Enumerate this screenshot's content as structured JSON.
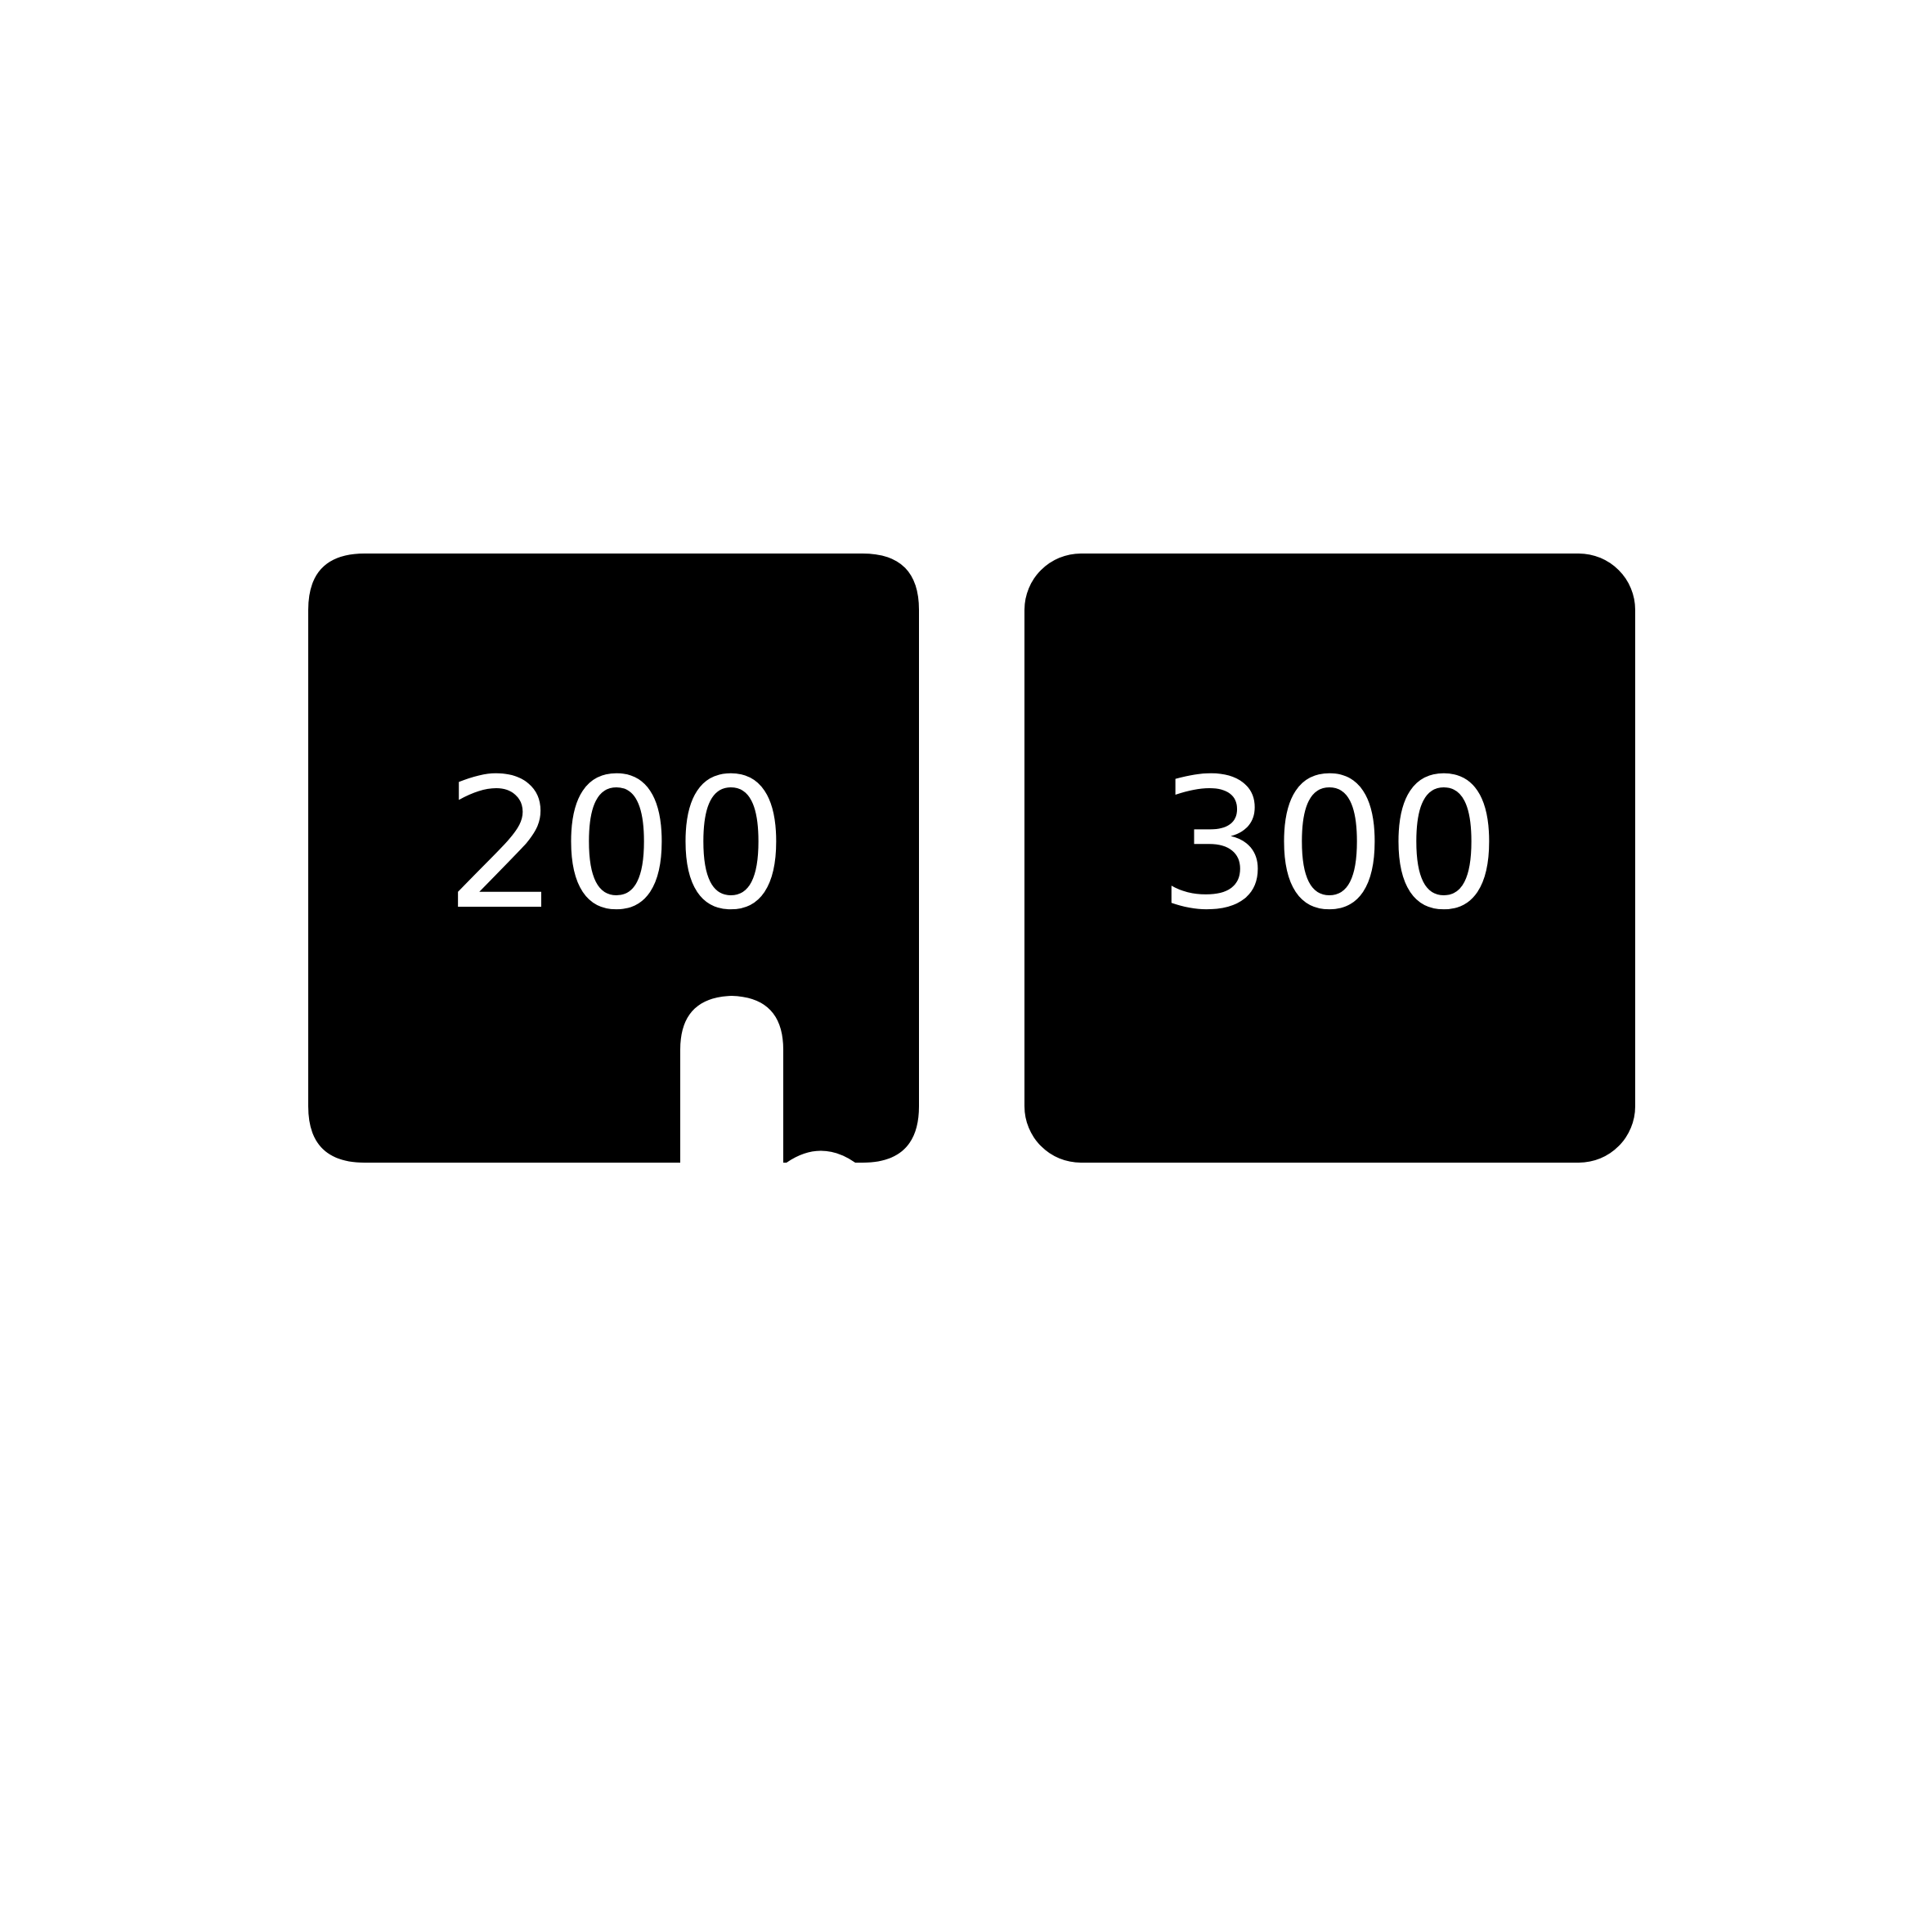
{
  "tiles": [
    {
      "label": "200"
    },
    {
      "label": "300"
    }
  ],
  "colors": {
    "background": "#ffffff",
    "tile": "#000000",
    "label": "#ffffff"
  },
  "icons": {
    "notch": "keyhole-notch-icon"
  }
}
